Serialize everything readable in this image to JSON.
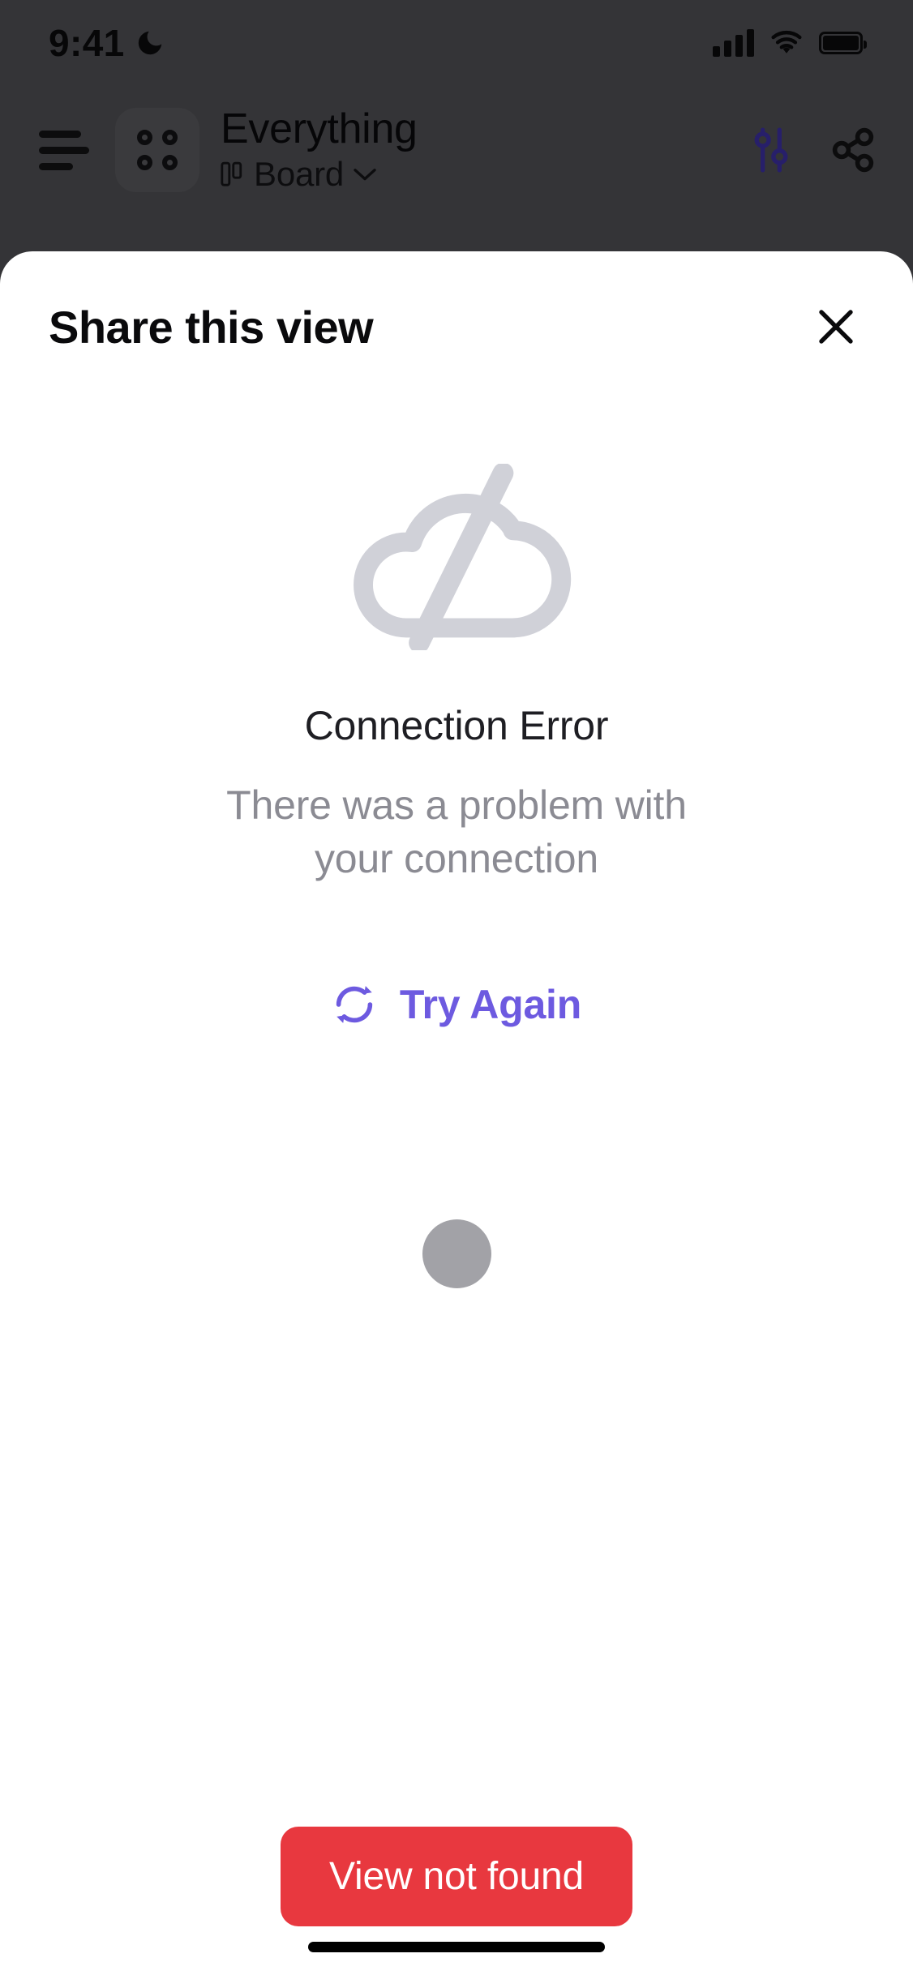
{
  "status_bar": {
    "time": "9:41",
    "dnd_icon": "moon-icon",
    "signal_icon": "cellular-signal-icon",
    "wifi_icon": "wifi-icon",
    "battery_icon": "battery-icon"
  },
  "app_nav": {
    "menu_icon": "hamburger-menu-icon",
    "grid_icon": "app-grid-icon",
    "title": "Everything",
    "view_type_icon": "board-layout-icon",
    "view_type": "Board",
    "view_chevron_icon": "chevron-down-icon",
    "filter_icon": "filter-sliders-icon",
    "share_icon": "share-nodes-icon"
  },
  "sheet": {
    "title": "Share this view",
    "close_icon": "close-icon",
    "error": {
      "illustration_icon": "cloud-off-icon",
      "title": "Connection Error",
      "description": "There was a problem with your connection",
      "retry_icon": "refresh-icon",
      "retry_label": "Try Again"
    },
    "placeholder": {
      "name": "avatar-placeholder-dot"
    },
    "toast": {
      "label": "View not found"
    }
  },
  "colors": {
    "accent_purple": "#6d5ae0",
    "error_red": "#e8383f",
    "backdrop_gray": "#4e4e52",
    "icon_gray": "#d0d1d8",
    "muted_text": "#8b8b93"
  }
}
